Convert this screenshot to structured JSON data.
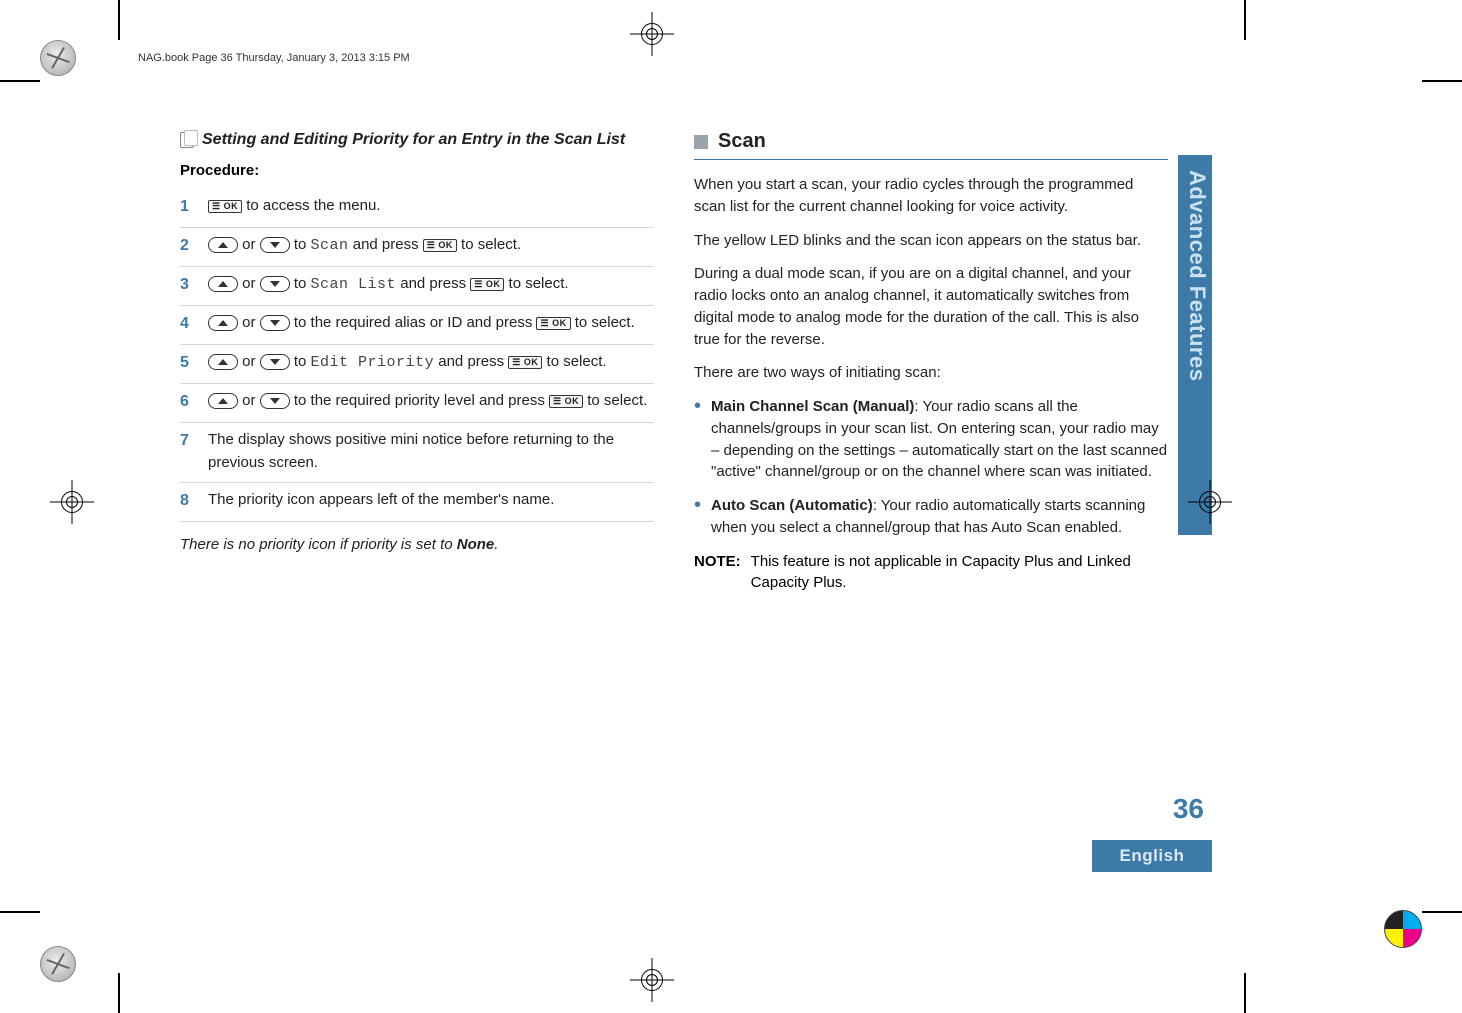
{
  "print_header": "NAG.book  Page 36  Thursday, January 3, 2013  3:15 PM",
  "side_tab": "Advanced Features",
  "page_number": "36",
  "language_tab": "English",
  "left": {
    "subsection_title": "Setting and Editing Priority for an Entry in the Scan List",
    "procedure_label": "Procedure:",
    "btn_ok": "OK",
    "steps": {
      "s1": {
        "tail": " to access the menu."
      },
      "s2": {
        "mid": " to ",
        "lcd": "Scan",
        "after": " and press ",
        "tail": " to select."
      },
      "s3": {
        "mid": " to ",
        "lcd": "Scan List",
        "after": " and press ",
        "tail": " to select."
      },
      "s4": {
        "mid": " to the required alias or ID and press ",
        "tail": " to select."
      },
      "s5": {
        "mid": " to ",
        "lcd": "Edit Priority",
        "after": " and press ",
        "tail": " to select."
      },
      "s6": {
        "mid": " to the required priority level and press ",
        "tail": " to select."
      },
      "s7": "The display shows positive mini notice before returning to the previous screen.",
      "s8": "The priority icon appears left of the member's name."
    },
    "footnote_pre": "There is no priority icon if priority is set to ",
    "footnote_bold": "None",
    "footnote_post": "."
  },
  "right": {
    "section_title": "Scan",
    "p1": "When you start a scan, your radio cycles through the programmed scan list for the current channel looking for voice activity.",
    "p2": "The yellow LED blinks and the scan icon appears on the status bar.",
    "p3": "During a dual mode scan, if you are on a digital channel, and your radio locks onto an analog channel, it automatically switches from digital mode to analog mode for the duration of the call. This is also true for the reverse.",
    "p4": "There are two ways of initiating scan:",
    "bullets": [
      {
        "bold": "Main Channel Scan (Manual)",
        "rest": ": Your radio scans all the channels/groups in your scan list. On entering scan, your radio may – depending on the settings – automatically start on the last scanned \"active\" channel/group or on the channel where scan was initiated."
      },
      {
        "bold": "Auto Scan (Automatic)",
        "rest": ": Your radio automatically starts scanning when you select a channel/group that has Auto Scan enabled."
      }
    ],
    "note_label": "NOTE:",
    "note_body": "This feature is not applicable in Capacity Plus and Linked Capacity Plus."
  }
}
